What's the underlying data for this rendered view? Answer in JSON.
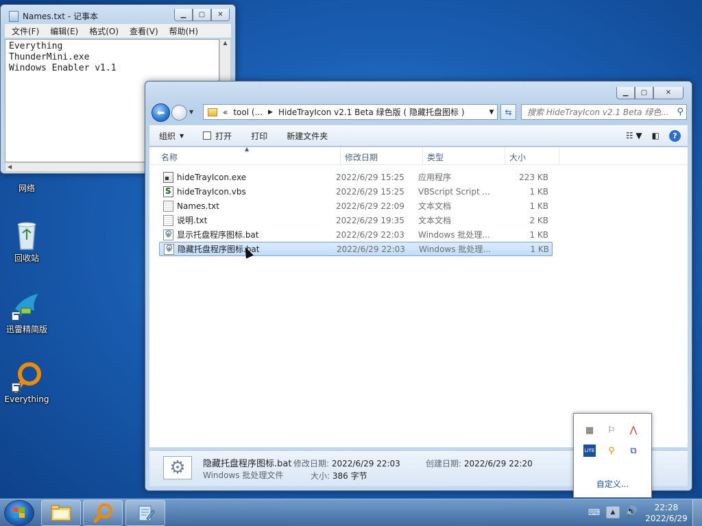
{
  "desktop": {
    "icons": [
      {
        "label": "网络",
        "icon": "network-icon"
      },
      {
        "label": "回收站",
        "icon": "recycle-bin-icon"
      },
      {
        "label": "迅雷精简版",
        "icon": "thunder-bird-icon"
      },
      {
        "label": "Everything",
        "icon": "everything-magnifier-icon"
      }
    ]
  },
  "notepad": {
    "title": "Names.txt - 记事本",
    "menu": [
      "文件(F)",
      "编辑(E)",
      "格式(O)",
      "查看(V)",
      "帮助(H)"
    ],
    "content": "Everything\nThunderMini.exe\nWindows Enabler v1.1"
  },
  "explorer": {
    "address": {
      "overflow": "«",
      "crumb1": "tool (...",
      "crumb2": "HideTrayIcon v2.1 Beta 绿色版 ( 隐藏托盘图标 )"
    },
    "search_placeholder": "搜索 HideTrayIcon v2.1 Beta 绿色...",
    "toolbar": {
      "organize": "组织",
      "open": "打开",
      "print": "打印",
      "new_folder": "新建文件夹"
    },
    "columns": [
      "名称",
      "修改日期",
      "类型",
      "大小"
    ],
    "files": [
      {
        "name": "hideTrayIcon.exe",
        "date": "2022/6/29 15:25",
        "type": "应用程序",
        "size": "223 KB",
        "kind": "exe"
      },
      {
        "name": "hideTrayIcon.vbs",
        "date": "2022/6/29 15:25",
        "type": "VBScript Script ...",
        "size": "1 KB",
        "kind": "vbs"
      },
      {
        "name": "Names.txt",
        "date": "2022/6/29 22:09",
        "type": "文本文档",
        "size": "1 KB",
        "kind": "txt"
      },
      {
        "name": "说明.txt",
        "date": "2022/6/29 19:35",
        "type": "文本文档",
        "size": "2 KB",
        "kind": "txt"
      },
      {
        "name": "显示托盘程序图标.bat",
        "date": "2022/6/29 22:03",
        "type": "Windows 批处理...",
        "size": "1 KB",
        "kind": "bat"
      },
      {
        "name": "隐藏托盘程序图标.bat",
        "date": "2022/6/29 22:03",
        "type": "Windows 批处理...",
        "size": "1 KB",
        "kind": "bat",
        "selected": true
      }
    ],
    "details": {
      "name": "隐藏托盘程序图标.bat",
      "type": "Windows 批处理文件",
      "modified_label": "修改日期:",
      "modified": "2022/6/29 22:03",
      "created_label": "创建日期:",
      "created": "2022/6/29 22:20",
      "size_label": "大小:",
      "size": "386 字节"
    }
  },
  "tray_flyout": {
    "customize": "自定义..."
  },
  "taskbar": {
    "time": "22:28",
    "date": "2022/6/29"
  }
}
